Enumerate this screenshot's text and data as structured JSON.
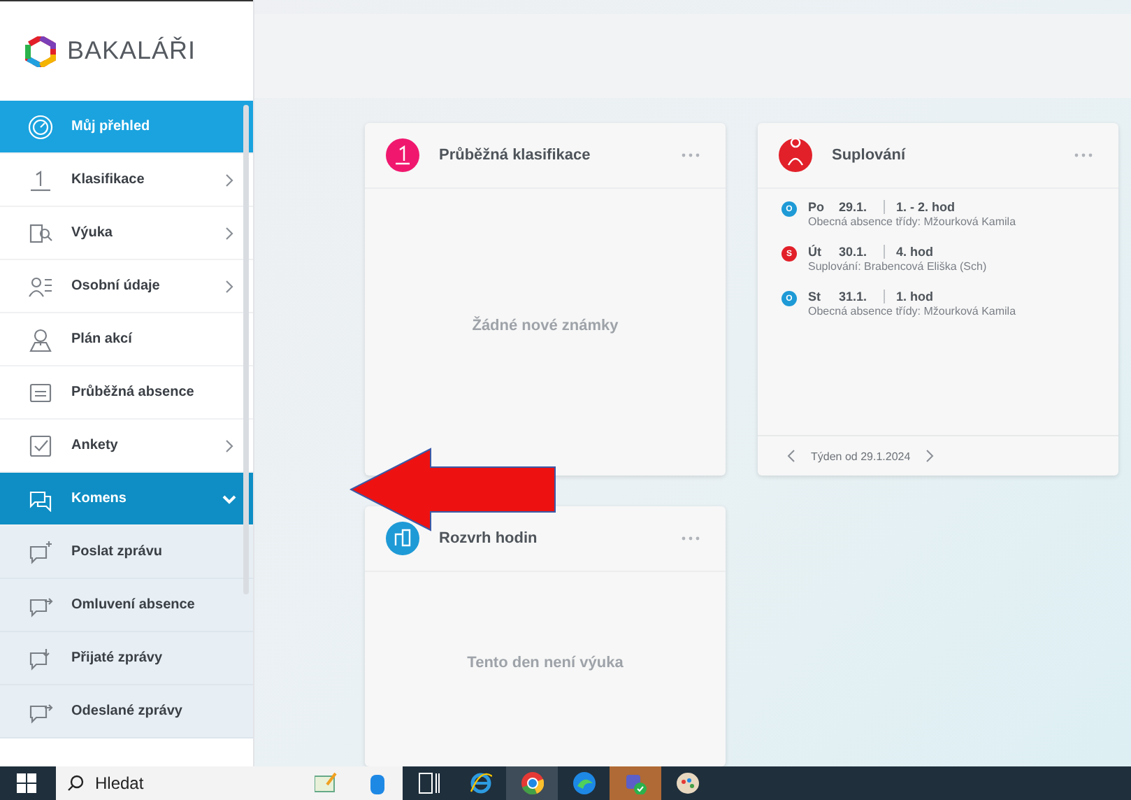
{
  "sidebar": {
    "logo": "BAKALÁŘI",
    "items": [
      {
        "label": "Můj přehled",
        "selected": true,
        "has_submenu": false,
        "expanded": false
      },
      {
        "label": "Klasifikace",
        "selected": false,
        "has_submenu": true,
        "expanded": false
      },
      {
        "label": "Výuka",
        "selected": false,
        "has_submenu": true,
        "expanded": false
      },
      {
        "label": "Osobní údaje",
        "selected": false,
        "has_submenu": true,
        "expanded": false
      },
      {
        "label": "Plán akcí",
        "selected": false,
        "has_submenu": false,
        "expanded": false
      },
      {
        "label": "Průběžná absence",
        "selected": false,
        "has_submenu": false,
        "expanded": false
      },
      {
        "label": "Ankety",
        "selected": false,
        "has_submenu": true,
        "expanded": false
      },
      {
        "label": "Komens",
        "selected": false,
        "has_submenu": true,
        "expanded": true,
        "children": [
          {
            "label": "Poslat zprávu"
          },
          {
            "label": "Omluvení absence"
          },
          {
            "label": "Přijaté zprávy"
          },
          {
            "label": "Odeslané zprávy"
          }
        ]
      }
    ]
  },
  "widgets": [
    {
      "kind": "empty",
      "title": "Průběžná klasifikace",
      "color": "#f0186e",
      "message": "Žádné nové známky"
    },
    {
      "kind": "list",
      "title": "Suplování",
      "color": "#e2202a",
      "entries": [
        {
          "badge": "O",
          "color": "#1e9ad6",
          "day": "Po",
          "date": "29.1.",
          "lessons": "1. - 2. hod",
          "note": "Obecná absence třídy: Mžourková Kamila"
        },
        {
          "badge": "S",
          "color": "#e2202a",
          "day": "Út",
          "date": "30.1.",
          "lessons": "4. hod",
          "note": "Suplování: Brabencová Eliška (Sch)"
        },
        {
          "badge": "O",
          "color": "#1e9ad6",
          "day": "St",
          "date": "31.1.",
          "lessons": "1. hod",
          "note": "Obecná absence třídy: Mžourková Kamila"
        }
      ],
      "footer": "Týden od 29.1.2024"
    },
    {
      "kind": "empty",
      "title": "Rozvrh hodin",
      "color": "#1e9ad6",
      "message": "Tento den není výuka"
    }
  ],
  "taskbar": {
    "search": {
      "placeholder": "Hledat"
    },
    "apps": [
      {
        "active": false,
        "attention": false
      },
      {
        "active": false,
        "attention": false
      },
      {
        "active": false,
        "attention": false
      },
      {
        "active": false,
        "attention": false
      },
      {
        "active": true,
        "attention": false
      },
      {
        "active": false,
        "attention": false
      },
      {
        "active": false,
        "attention": true
      },
      {
        "active": false,
        "attention": false
      }
    ]
  }
}
